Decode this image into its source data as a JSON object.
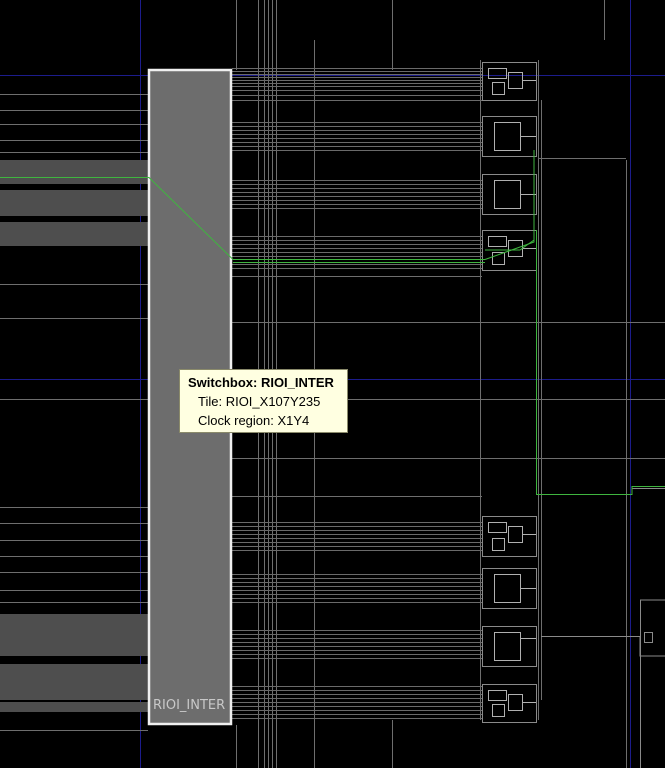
{
  "switchbox": {
    "label": "RIOI_INTER"
  },
  "tooltip": {
    "title": "Switchbox: RIOI_INTER",
    "tile": "Tile: RIOI_X107Y235",
    "clock_region": "Clock region: X1Y4"
  },
  "colors": {
    "background": "#000000",
    "wire": "#6e6e6e",
    "bus": "#5a5a5a",
    "selected_net": "#3fb53f",
    "clock_boundary": "#1c1c8c",
    "switchbox_fill": "#6d6d6d",
    "switchbox_border": "#f0f0f0",
    "tooltip_bg": "#ffffe1"
  },
  "icons": [
    "io-tile-icon"
  ]
}
